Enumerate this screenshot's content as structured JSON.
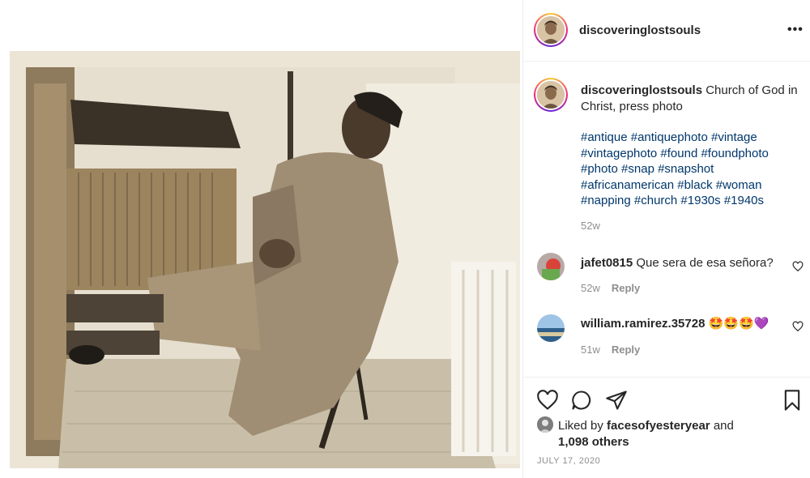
{
  "post": {
    "username": "discoveringlostsouls",
    "more_label": "•••",
    "caption": "Church of God in Christ, press photo",
    "hashtags": "#antique #antiquephoto #vintage #vintagephoto #found #foundphoto #photo #snap #snapshot #africanamerican #black #woman #napping #church #1930s #1940s",
    "caption_time": "52w"
  },
  "comments": [
    {
      "username": "jafet0815",
      "text": "Que sera de esa señora?",
      "time": "52w",
      "reply_label": "Reply"
    },
    {
      "username": "william.ramirez.35728",
      "text": "🤩🤩🤩💜",
      "time": "51w",
      "reply_label": "Reply"
    }
  ],
  "likes": {
    "prefix": "Liked by",
    "user": "facesofyesteryear",
    "and": "and",
    "others": "1,098 others"
  },
  "date": "JULY 17, 2020",
  "colors": {
    "link": "#00376b",
    "muted": "#8e8e8e",
    "text": "#262626",
    "border": "#efefef"
  },
  "icons": [
    "heart-icon",
    "comment-icon",
    "share-icon",
    "bookmark-icon",
    "more-icon"
  ]
}
